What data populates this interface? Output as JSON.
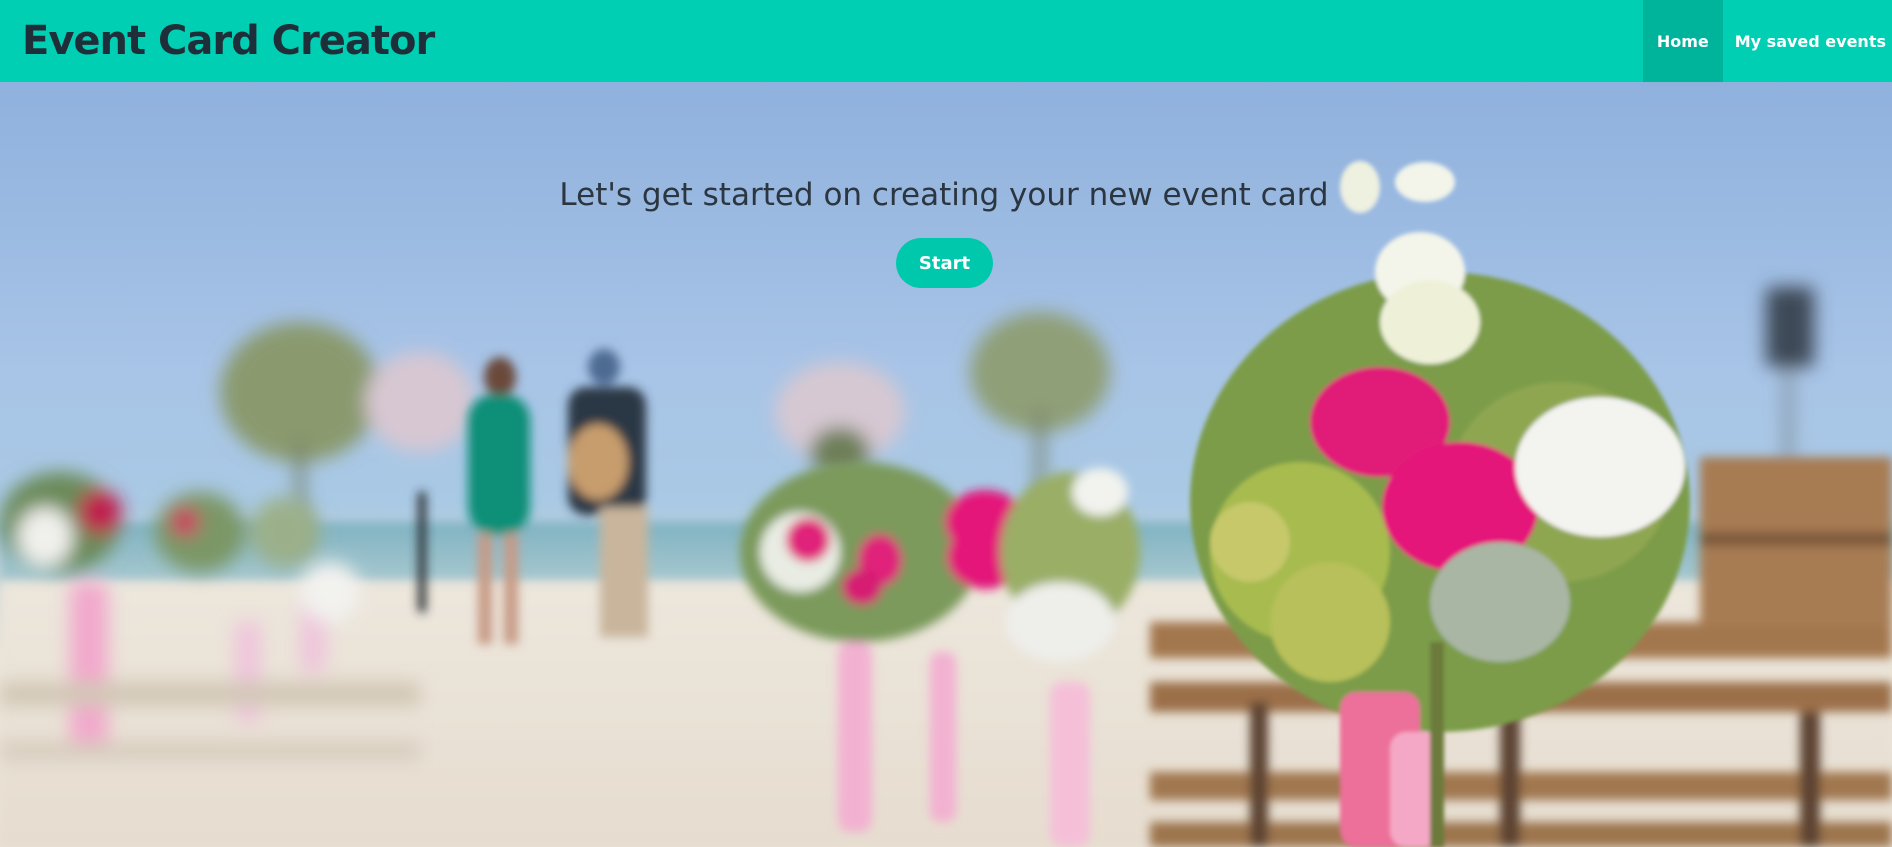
{
  "navbar": {
    "brand": "Event Card Creator",
    "links": [
      {
        "label": "Home",
        "active": true
      },
      {
        "label": "My saved events",
        "active": false
      }
    ],
    "colors": {
      "bar": "#00cfb4",
      "active": "#00b49c"
    }
  },
  "hero": {
    "title": "Let's get started on creating your new event card",
    "start_button": "Start",
    "background_image": "blurred beach wedding ceremony with flower bouquet on chair",
    "colors": {
      "button": "#00c8ad",
      "title": "#2b3640"
    }
  }
}
